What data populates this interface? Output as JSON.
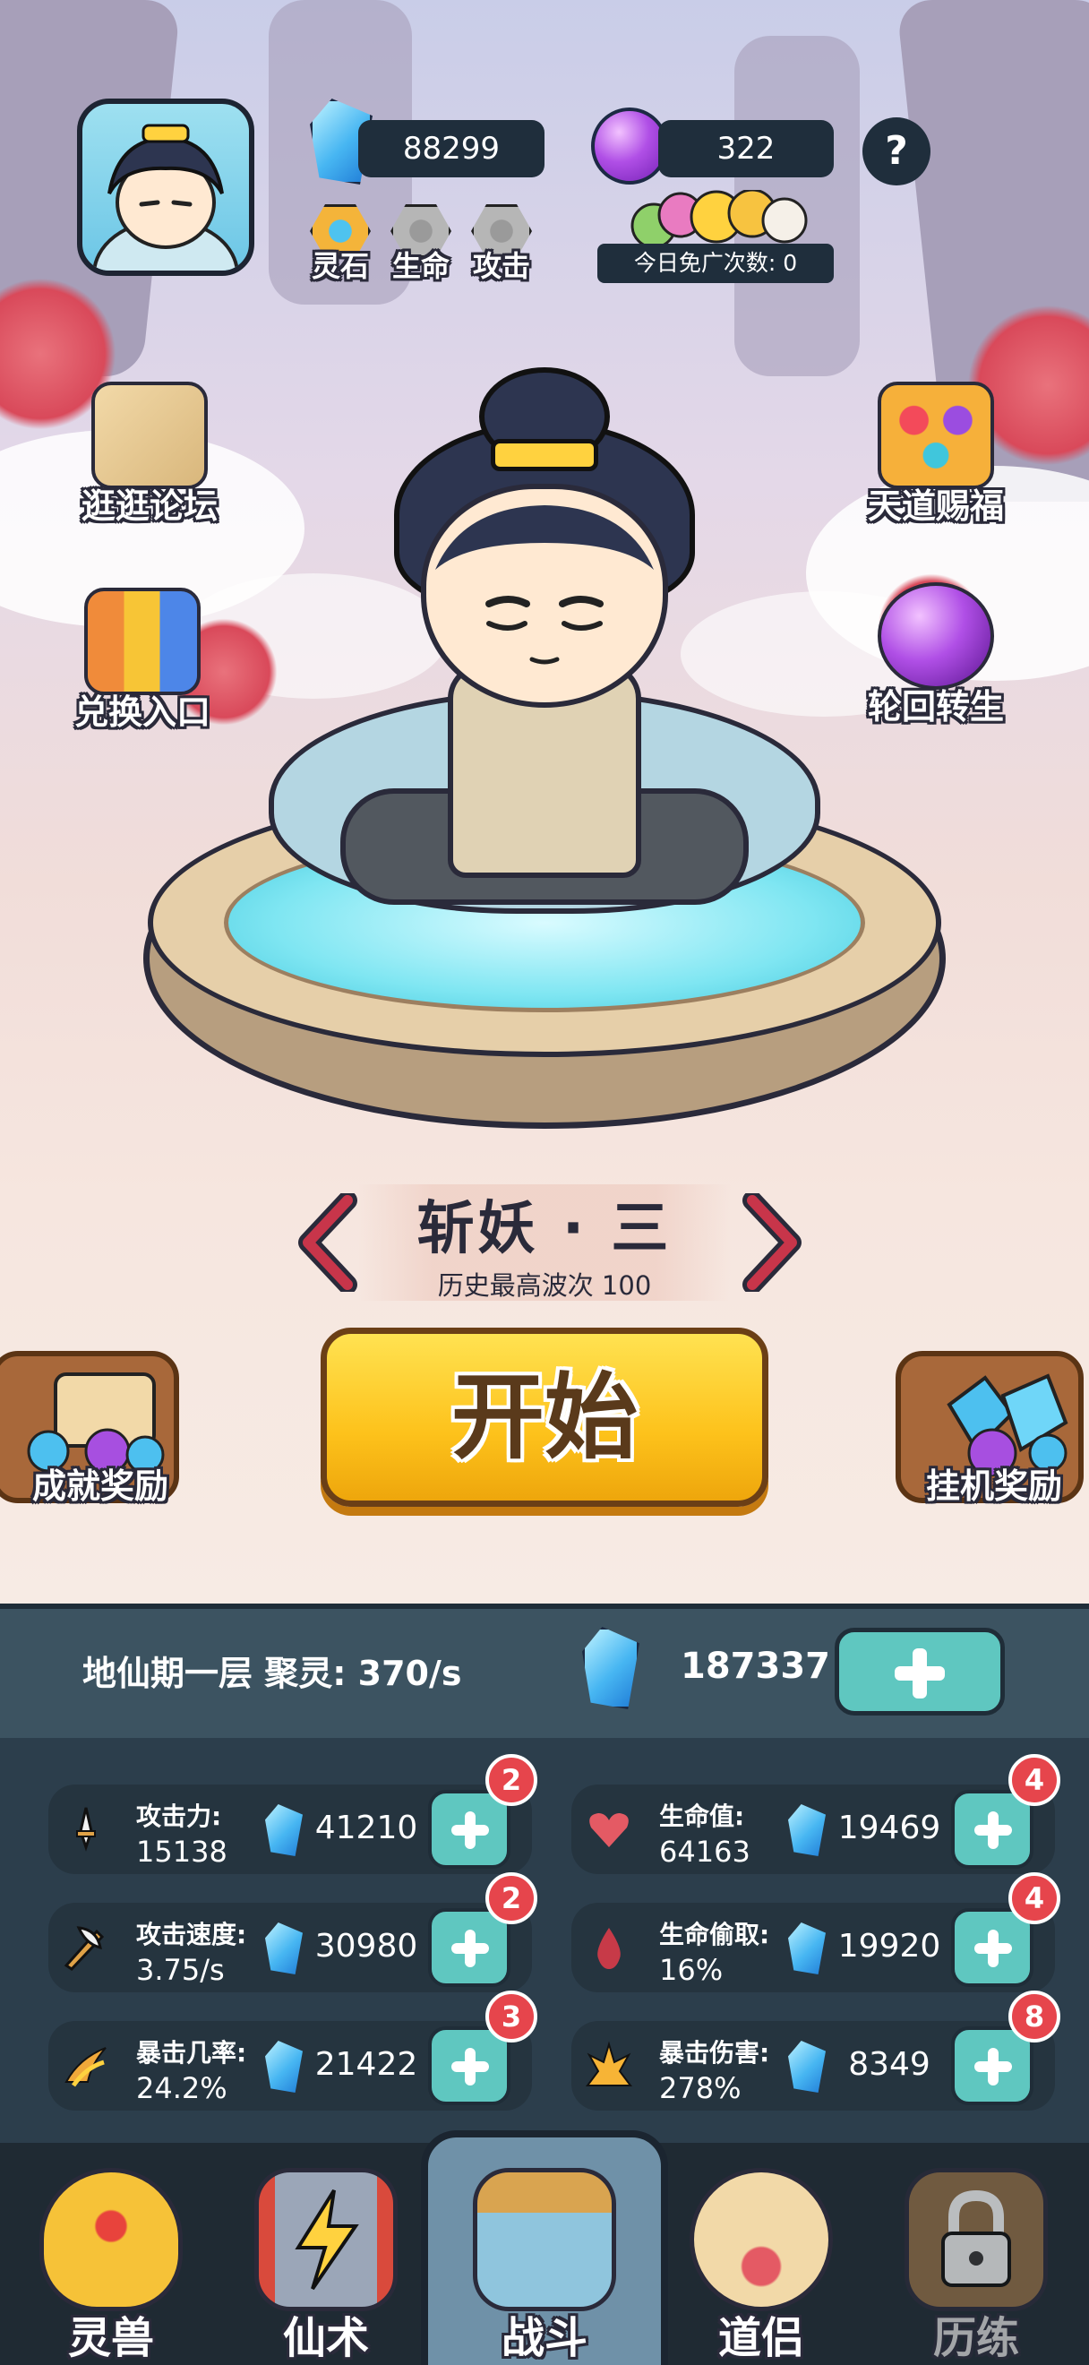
{
  "header": {
    "spirit_stones": "88299",
    "purple_gems": "322",
    "help": "?",
    "tabs": [
      {
        "label": "灵石",
        "icon": "spirit-stone-badge-icon"
      },
      {
        "label": "生命",
        "icon": "life-badge-icon"
      },
      {
        "label": "攻击",
        "icon": "attack-badge-icon"
      }
    ],
    "free_ads_label": "今日免广次数: 0"
  },
  "side_left": [
    {
      "label": "逛逛论坛",
      "icon": "forum-map-icon"
    },
    {
      "label": "兑换入口",
      "icon": "exchange-gift-icon"
    }
  ],
  "side_right": [
    {
      "label": "天道赐福",
      "icon": "blessing-gems-icon"
    },
    {
      "label": "轮回转生",
      "icon": "reincarnation-orb-icon"
    }
  ],
  "stage": {
    "title": "斩妖 · 三",
    "best_wave": "历史最高波次 100"
  },
  "start_label": "开始",
  "rewards": {
    "left_label": "成就奖励",
    "right_label": "挂机奖励"
  },
  "cultivation": {
    "realm": "地仙期一层 聚灵: 370/s",
    "total": "187337"
  },
  "stats": [
    {
      "name": "攻击力:",
      "value": "15138",
      "cost": "41210",
      "badge": "2",
      "icon": "sword-icon"
    },
    {
      "name": "生命值:",
      "value": "64163",
      "cost": "19469",
      "badge": "4",
      "icon": "heart-icon"
    },
    {
      "name": "攻击速度:",
      "value": "3.75/s",
      "cost": "30980",
      "badge": "2",
      "icon": "wing-sword-icon"
    },
    {
      "name": "生命偷取:",
      "value": "16%",
      "cost": "19920",
      "badge": "4",
      "icon": "blood-drop-icon"
    },
    {
      "name": "暴击几率:",
      "value": "24.2%",
      "cost": "21422",
      "badge": "3",
      "icon": "crit-claw-icon"
    },
    {
      "name": "暴击伤害:",
      "value": "278%",
      "cost": "8349",
      "badge": "8",
      "icon": "flame-burst-icon"
    }
  ],
  "nav": [
    {
      "label": "灵兽",
      "icon": "spirit-beast-egg-icon",
      "active": false,
      "locked": false
    },
    {
      "label": "仙术",
      "icon": "lightning-scroll-icon",
      "active": false,
      "locked": false
    },
    {
      "label": "战斗",
      "icon": "battle-sword-icon",
      "active": true,
      "locked": false
    },
    {
      "label": "道侣",
      "icon": "companion-heart-icon",
      "active": false,
      "locked": false
    },
    {
      "label": "历练",
      "icon": "lock-icon",
      "active": false,
      "locked": true
    }
  ],
  "colors": {
    "panel_bg": "#2c3e4c",
    "upgrade_button": "#5fc7c0",
    "badge_red": "#e6454c",
    "start_button": "#fdc21b"
  }
}
